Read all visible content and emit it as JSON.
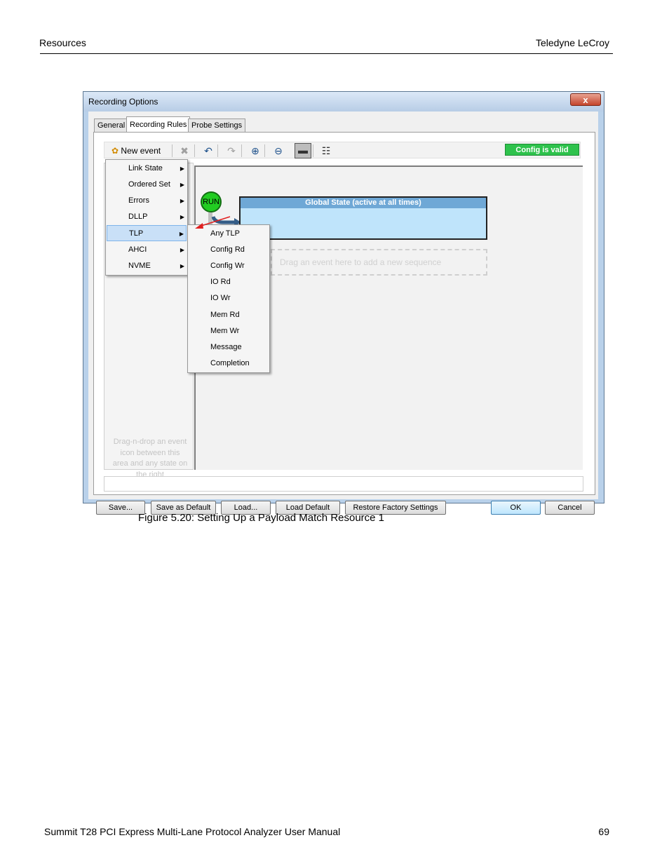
{
  "page": {
    "header_left": "Resources",
    "header_right": "Teledyne LeCroy",
    "footer_left": "Summit T28 PCI Express Multi-Lane Protocol Analyzer User Manual",
    "footer_page": "69"
  },
  "window": {
    "title": "Recording Options",
    "close_glyph": "x",
    "tabs": [
      "General",
      "Recording Rules",
      "Probe Settings"
    ],
    "toolbar": {
      "new_event_label": "New event",
      "icons": [
        "delete-event-icon",
        "undo-icon",
        "redo-icon",
        "zoom-in-icon",
        "zoom-out-icon",
        "overview-icon",
        "properties-icon"
      ]
    },
    "config_status": "Config is valid",
    "run_label": "RUN",
    "global_state_title": "Global State (active at all times)",
    "drop_sequence_hint": "Drag an event here to add a new sequence",
    "left_panel_hint": "Drag-n-drop an event icon between this area and any state on the right",
    "event_menu": {
      "items": [
        "Link State",
        "Ordered Set",
        "Errors",
        "DLLP",
        "TLP",
        "AHCI",
        "NVME"
      ],
      "selected": "TLP"
    },
    "tlp_submenu": {
      "items": [
        "Any TLP",
        "Config Rd",
        "Config Wr",
        "IO Rd",
        "IO Wr",
        "Mem Rd",
        "Mem Wr",
        "Message",
        "Completion"
      ]
    },
    "buttons": {
      "save": "Save...",
      "save_default": "Save as Default",
      "load": "Load...",
      "load_default": "Load Default",
      "restore": "Restore Factory Settings",
      "ok": "OK",
      "cancel": "Cancel"
    }
  },
  "caption": "Figure 5.20:  Setting Up a Payload Match Resource 1"
}
